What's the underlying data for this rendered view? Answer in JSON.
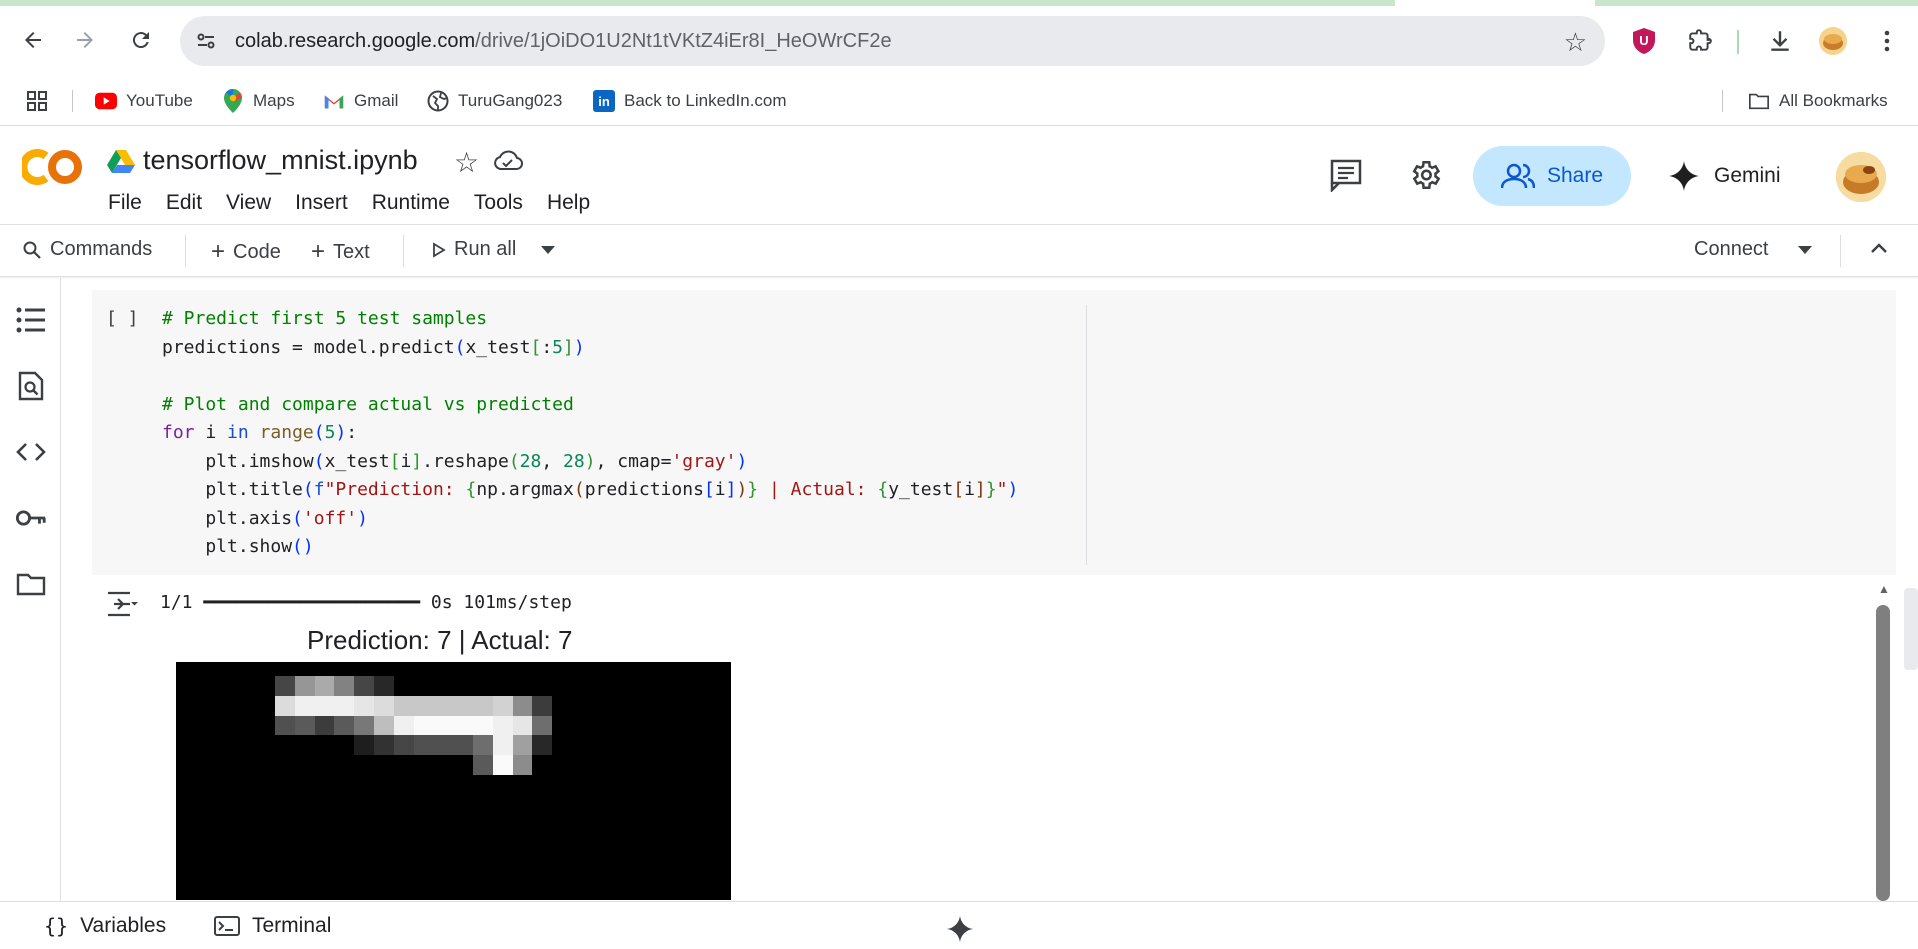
{
  "browser": {
    "url_host": "colab.research.google.com",
    "url_path": "/drive/1jOiDO1U2Nt1tVKtZ4iEr8I_HeOWrCF2e"
  },
  "bookmarks": [
    {
      "label": "YouTube",
      "icon": "youtube-icon"
    },
    {
      "label": "Maps",
      "icon": "maps-icon"
    },
    {
      "label": "Gmail",
      "icon": "gmail-icon"
    },
    {
      "label": "TuruGang023",
      "icon": "globe-icon"
    },
    {
      "label": "Back to LinkedIn.com",
      "icon": "linkedin-icon"
    }
  ],
  "all_bookmarks_label": "All Bookmarks",
  "colab": {
    "logo_text": "CO",
    "notebook_title": "tensorflow_mnist.ipynb",
    "menu": [
      "File",
      "Edit",
      "View",
      "Insert",
      "Runtime",
      "Tools",
      "Help"
    ],
    "share_label": "Share",
    "gemini_label": "Gemini"
  },
  "toolbar": {
    "commands_label": "Commands",
    "code_label": "Code",
    "text_label": "Text",
    "run_all_label": "Run all",
    "connect_label": "Connect"
  },
  "cell": {
    "bracket": "[ ]",
    "code_lines": [
      "# Predict first 5 test samples",
      "predictions = model.predict(x_test[:5])",
      "",
      "# Plot and compare actual vs predicted",
      "for i in range(5):",
      "    plt.imshow(x_test[i].reshape(28, 28), cmap='gray')",
      "    plt.title(f\"Prediction: {np.argmax(predictions[i])} | Actual: {y_test[i]}\")",
      "    plt.axis('off')",
      "    plt.show()"
    ]
  },
  "output": {
    "progress_text": "1/1 ━━━━━━━━━━━━━━━━━━━━ 0s 101ms/step",
    "plot_title": "Prediction: 7 | Actual: 7"
  },
  "bottombar": {
    "variables_label": "Variables",
    "terminal_label": "Terminal"
  },
  "colors": {
    "share_bg": "#c2e7ff",
    "share_text": "#0b57d0",
    "logo_yellow": "#f9ab00",
    "logo_orange": "#e8710a",
    "cell_bg": "#f7f7f7"
  }
}
